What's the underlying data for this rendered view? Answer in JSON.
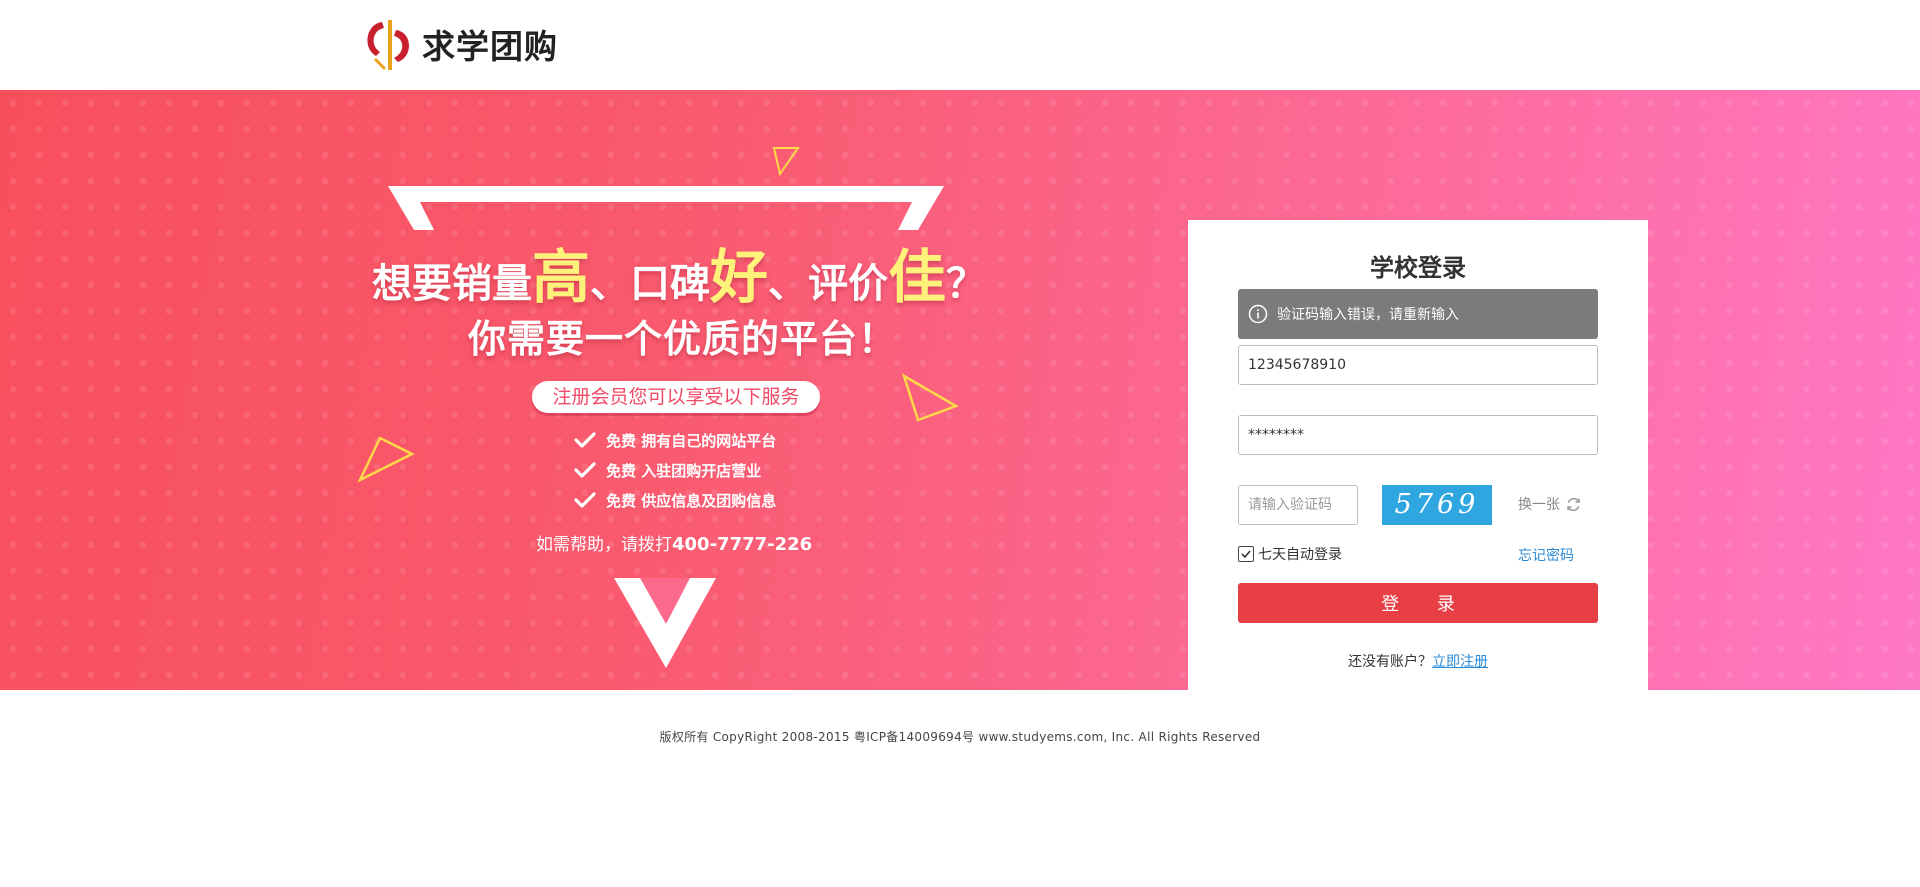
{
  "header": {
    "logo_text": "求学团购"
  },
  "banner": {
    "headline": {
      "p1": "想要销量",
      "w1": "高",
      "p2": "、口碑",
      "w2": "好",
      "p3": "、评价",
      "w3": "佳",
      "p4": "？"
    },
    "subheadline": "你需要一个优质的平台！",
    "pill": "注册会员您可以享受以下服务",
    "benefits": [
      "免费  拥有自己的网站平台",
      "免费  入驻团购开店营业",
      "免费  供应信息及团购信息"
    ],
    "hotline_prefix": "如需帮助，请拨打",
    "hotline_number": "400-7777-226"
  },
  "login": {
    "title": "学校登录",
    "alert": "验证码输入错误，请重新输入",
    "username_value": "12345678910",
    "password_value": "********",
    "captcha_placeholder": "请输入验证码",
    "captcha_code": "5769",
    "refresh_label": "换一张",
    "remember_label": "七天自动登录",
    "forgot_label": "忘记密码",
    "submit_label": "登 录",
    "register_prompt": "还没有账户？",
    "register_link": "立即注册"
  },
  "footer": {
    "copyright": "版权所有 CopyRight 2008-2015 粤ICP备14009694号 www.studyems.com, Inc. All Rights Reserved"
  },
  "colors": {
    "brand_red": "#e83f47",
    "link_blue": "#2a8ad6",
    "captcha_blue": "#2fa6e0",
    "highlight_yellow": "#fff27a"
  }
}
